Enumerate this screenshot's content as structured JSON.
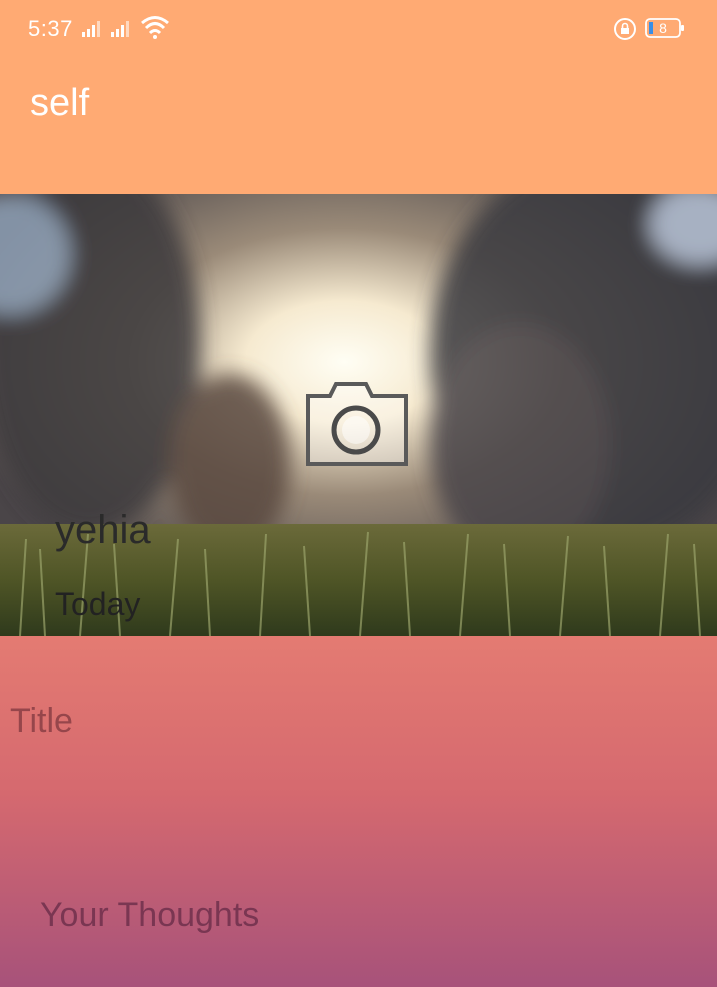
{
  "status_bar": {
    "time": "5:37",
    "battery_level": "8"
  },
  "toolbar": {
    "title": "self"
  },
  "header": {
    "user_name": "yehia",
    "date": "Today",
    "camera_icon": "camera-icon"
  },
  "form": {
    "title_placeholder": "Title",
    "thoughts_placeholder": "Your Thoughts"
  },
  "colors": {
    "toolbar": "#FFAA73",
    "form_top": "#E47B72",
    "form_bottom": "#A7527A"
  }
}
